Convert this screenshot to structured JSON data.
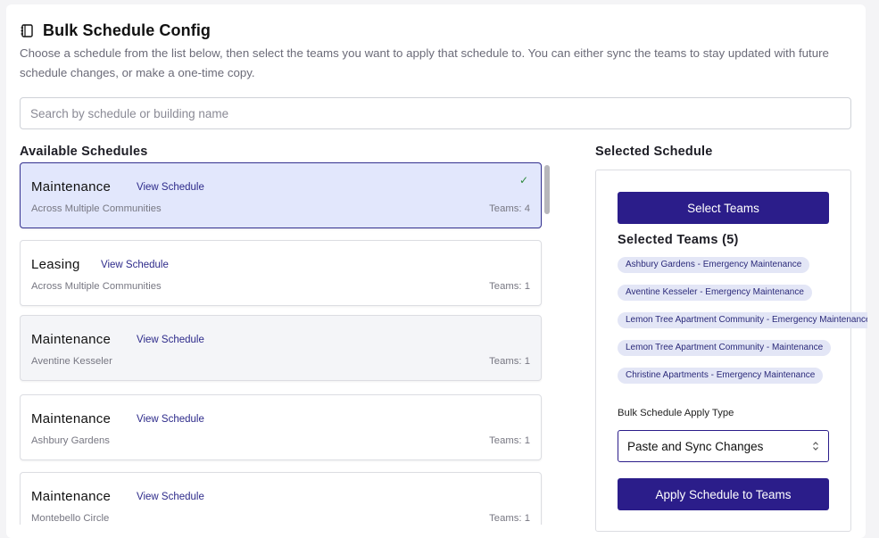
{
  "header": {
    "title": "Bulk Schedule Config",
    "description": "Choose a schedule from the list below, then select the teams you want to apply that schedule to. You can either sync the teams to stay updated with future schedule changes, or make a one-time copy."
  },
  "search": {
    "placeholder": "Search by schedule or building name"
  },
  "available": {
    "heading": "Available Schedules",
    "view_label": "View Schedule",
    "schedules": [
      {
        "name": "Maintenance",
        "location": "Across Multiple Communities",
        "teams": "Teams: 4",
        "selected": true
      },
      {
        "name": "Leasing",
        "location": "Across Multiple Communities",
        "teams": "Teams: 1"
      },
      {
        "name": "Maintenance",
        "location": "Aventine Kesseler",
        "teams": "Teams: 1"
      },
      {
        "name": "Maintenance",
        "location": "Ashbury Gardens",
        "teams": "Teams: 1"
      },
      {
        "name": "Maintenance",
        "location": "Montebello Circle",
        "teams": "Teams: 1"
      }
    ]
  },
  "selected": {
    "heading": "Selected Schedule",
    "select_teams_label": "Select Teams",
    "teams_title": "Selected Teams (5)",
    "teams": [
      "Ashbury Gardens - Emergency Maintenance",
      "Aventine Kesseler - Emergency Maintenance",
      "Lemon Tree Apartment Community - Emergency Maintenance",
      "Lemon Tree Apartment Community - Maintenance",
      "Christine Apartments - Emergency Maintenance"
    ],
    "apply_type_label": "Bulk Schedule Apply Type",
    "apply_type_value": "Paste and Sync Changes",
    "apply_button_label": "Apply Schedule to Teams"
  },
  "colors": {
    "primary": "#2b1d8a",
    "selected_card_bg": "#e2e7fc",
    "chip_bg": "#e3e6f6",
    "check": "#2e8a3d"
  },
  "icons": {
    "title_icon": "notebook-icon",
    "selected_check": "check-icon",
    "select_arrows": "chevron-up-down-icon"
  }
}
